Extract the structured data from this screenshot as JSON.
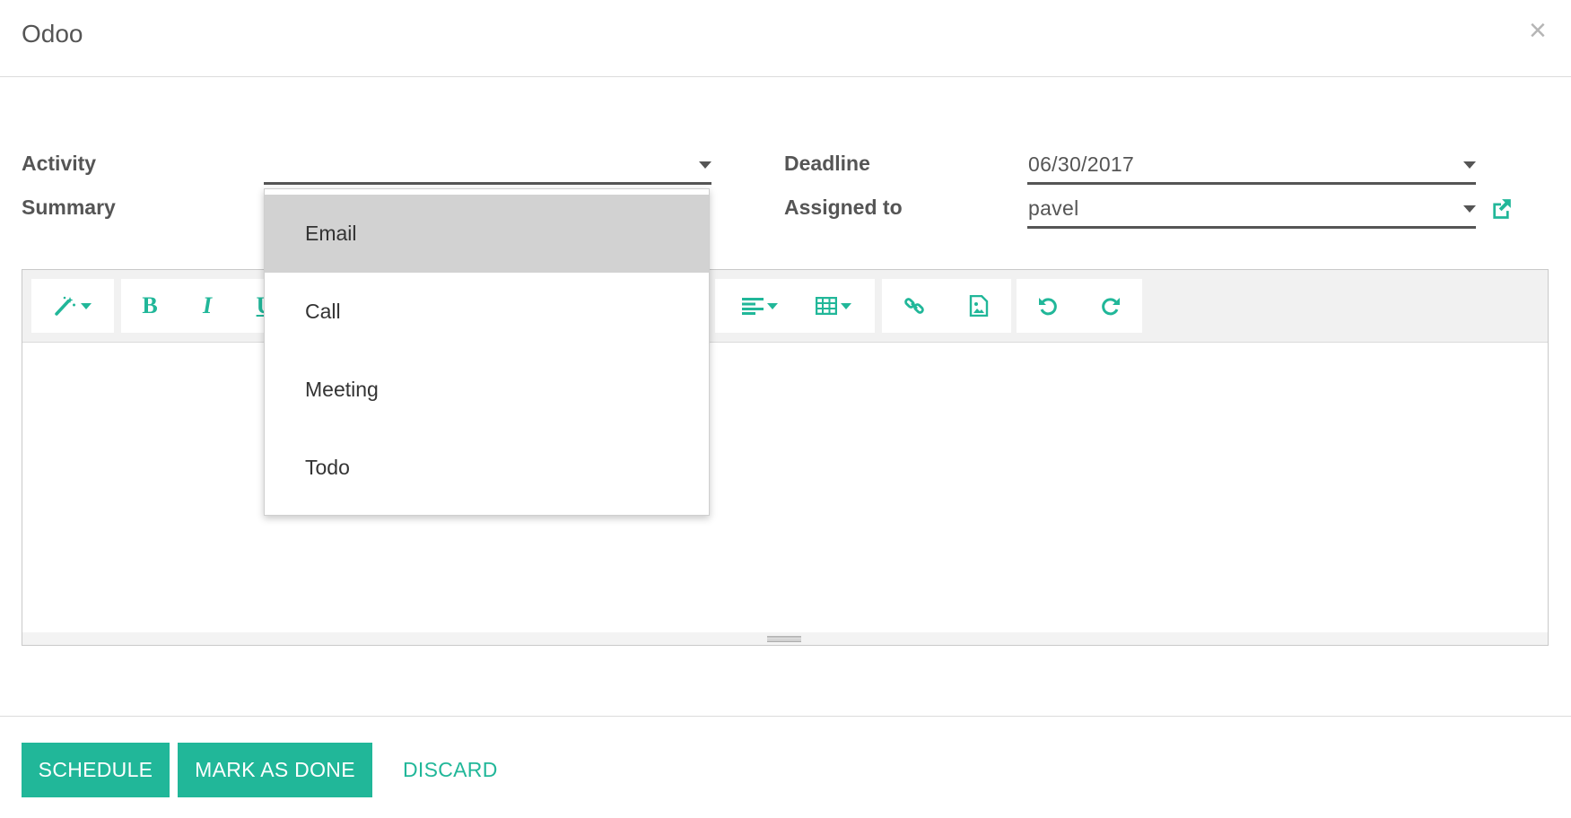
{
  "dialog": {
    "title": "Odoo",
    "close_label": "×"
  },
  "form": {
    "activity": {
      "label": "Activity",
      "value": ""
    },
    "summary": {
      "label": "Summary",
      "value": ""
    },
    "deadline": {
      "label": "Deadline",
      "value": "06/30/2017"
    },
    "assigned_to": {
      "label": "Assigned to",
      "value": "pavel"
    }
  },
  "dropdown": {
    "options": [
      "Email",
      "Call",
      "Meeting",
      "Todo"
    ],
    "highlighted": "Email"
  },
  "toolbar": {
    "icons": [
      "magic-wand-icon",
      "bold-icon",
      "italic-icon",
      "underline-icon",
      "align-left-icon",
      "table-icon",
      "link-icon",
      "picture-icon",
      "undo-icon",
      "redo-icon"
    ]
  },
  "footer": {
    "schedule_label": "SCHEDULE",
    "mark_done_label": "MARK AS DONE",
    "discard_label": "DISCARD"
  },
  "colors": {
    "accent": "#21b799",
    "dropdown_highlight": "#d2d2d2",
    "text": "#555555"
  }
}
